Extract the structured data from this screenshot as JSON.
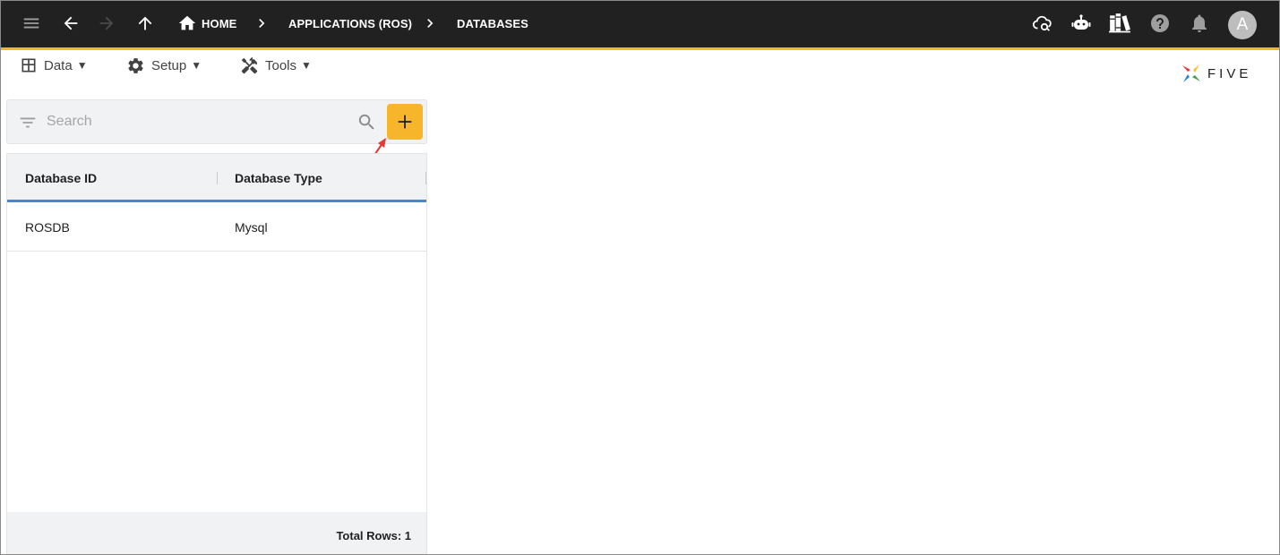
{
  "appbar": {
    "breadcrumbs": [
      {
        "label": "HOME",
        "icon": "home-icon"
      },
      {
        "label": "APPLICATIONS (ROS)"
      },
      {
        "label": "DATABASES"
      }
    ],
    "nav_icons": [
      "menu-icon",
      "arrow-back-icon",
      "arrow-forward-icon",
      "arrow-upward-icon"
    ],
    "action_icons": [
      "cloud-sync-icon",
      "chatbot-icon",
      "library-books-icon",
      "help-icon",
      "notifications-icon"
    ],
    "avatar_initial": "A",
    "accent_color": "#f7b52c",
    "background_color": "#212121"
  },
  "menu": {
    "items": [
      {
        "label": "Data",
        "icon": "table-icon",
        "caret": "▼"
      },
      {
        "label": "Setup",
        "icon": "gear-icon",
        "caret": "▼"
      },
      {
        "label": "Tools",
        "icon": "tools-icon",
        "caret": "▼"
      }
    ]
  },
  "logo": {
    "text": "FIVE"
  },
  "search": {
    "placeholder": "Search",
    "value": ""
  },
  "grid": {
    "columns": [
      "Database ID",
      "Database Type"
    ],
    "rows": [
      [
        "ROSDB",
        "Mysql"
      ]
    ],
    "footer": "Total Rows: 1",
    "header_underline_color": "#4a86c8"
  },
  "add_button": {
    "icon": "plus-icon",
    "color": "#f7b52c"
  }
}
